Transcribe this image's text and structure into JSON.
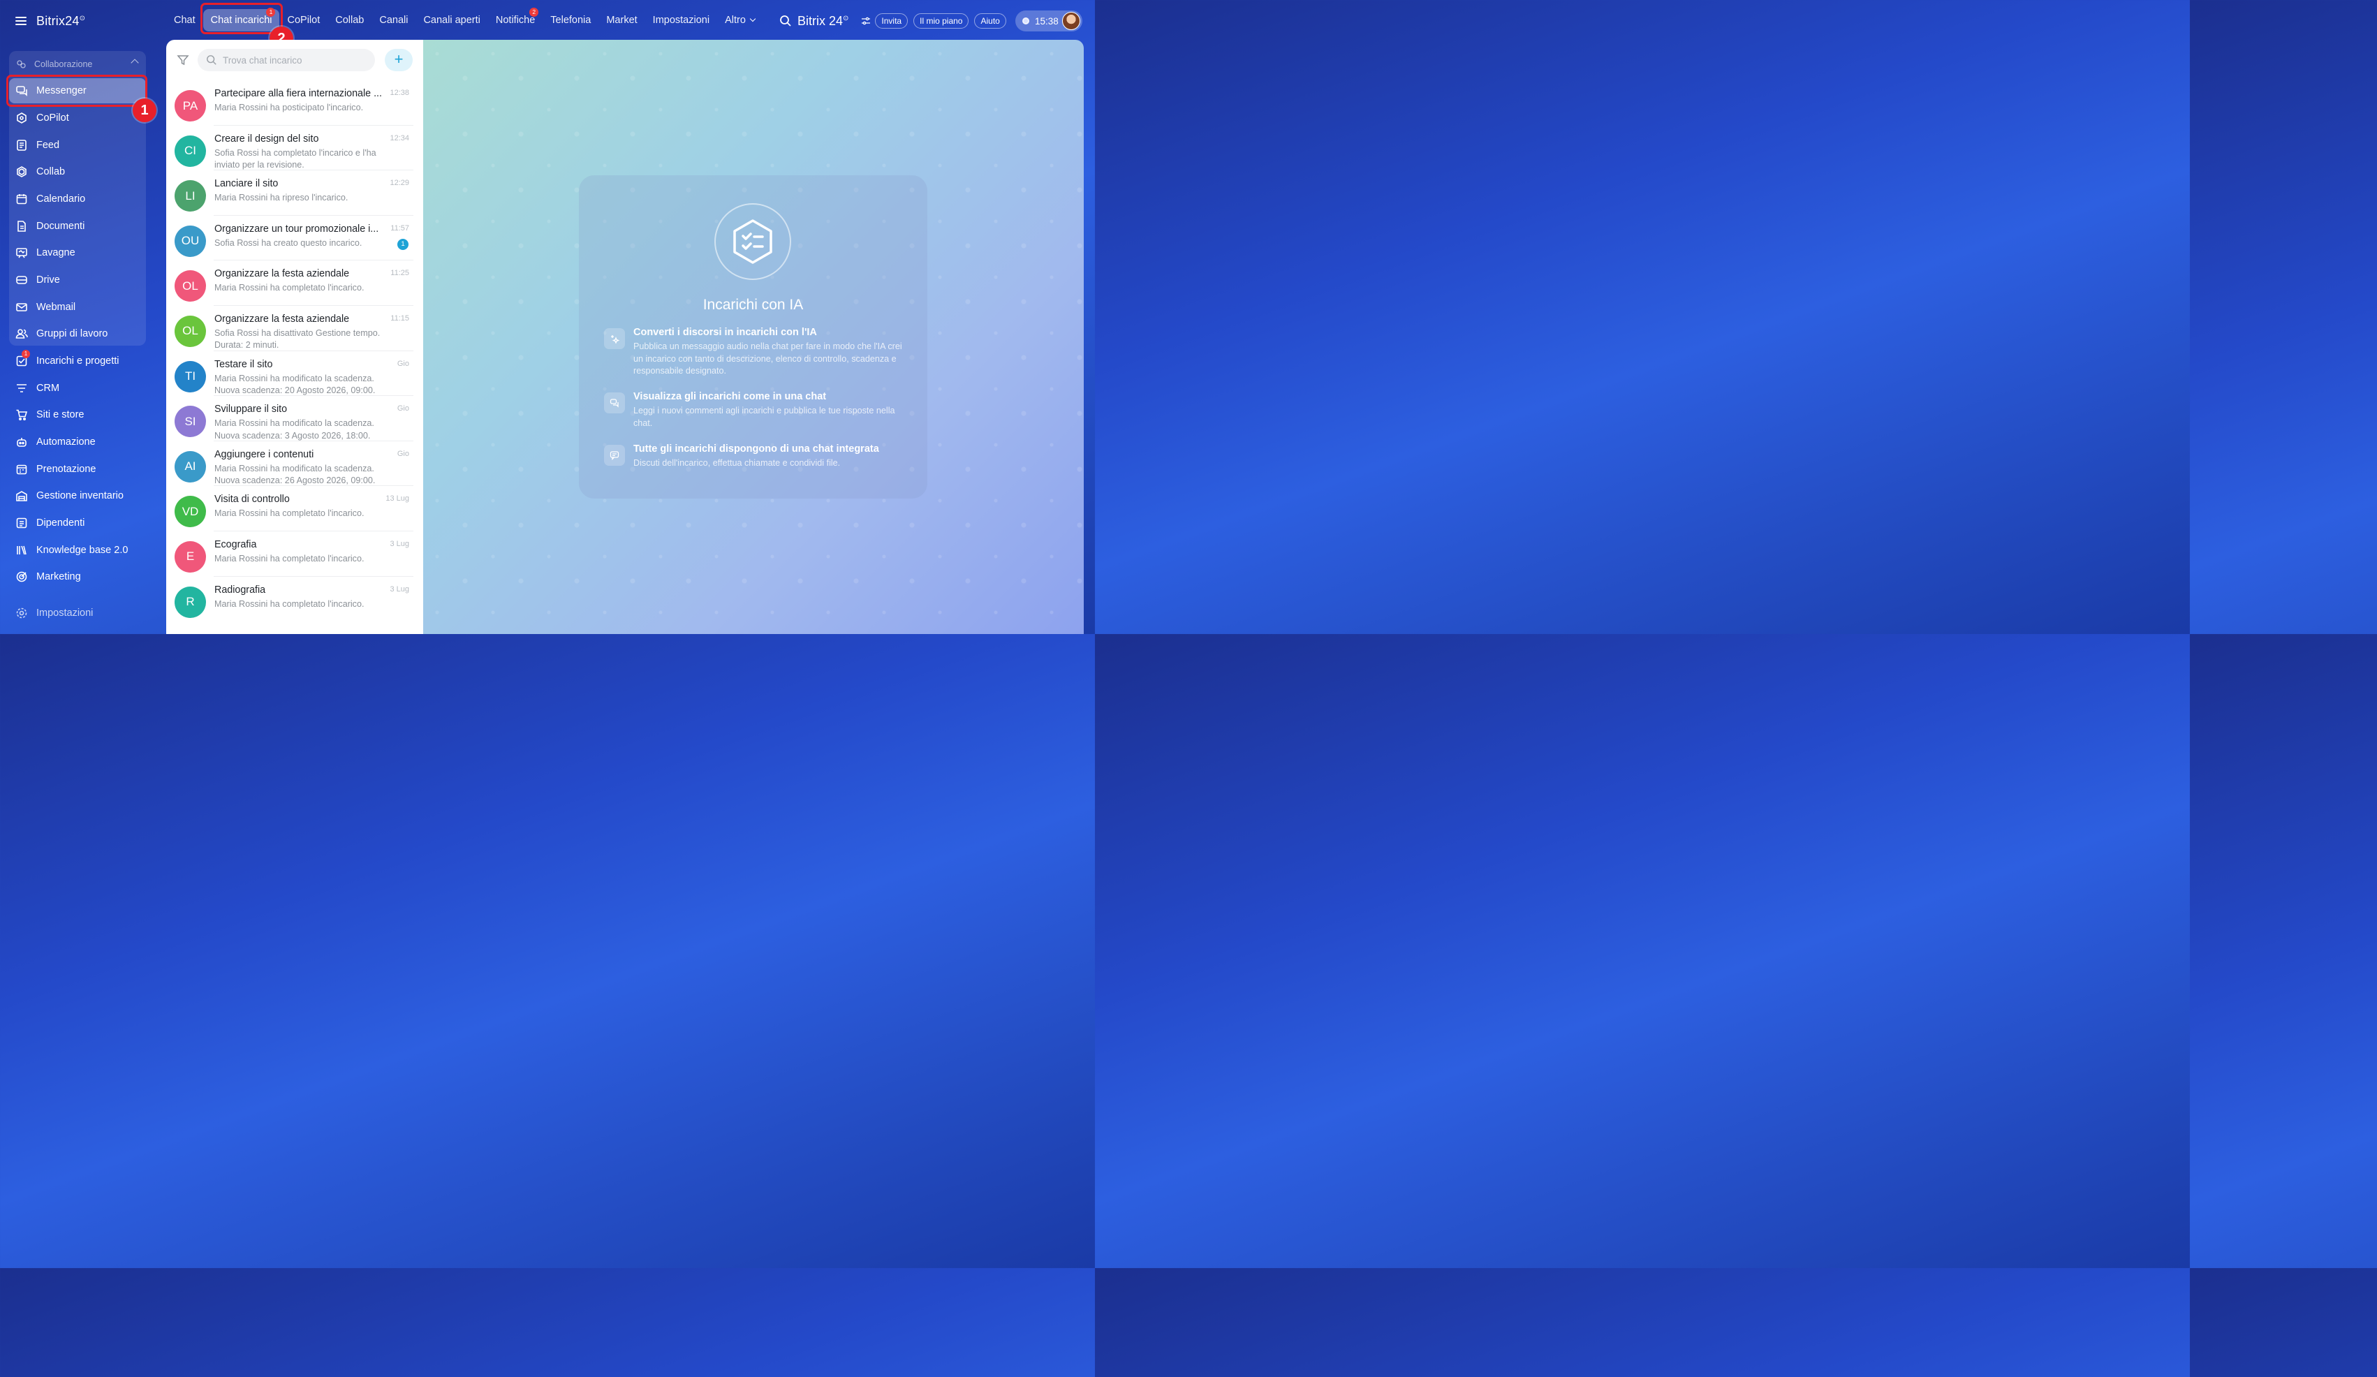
{
  "app": {
    "logo": "Bitrix24",
    "logo_mark": "⊙"
  },
  "sidebar": {
    "group_label": "Collaborazione",
    "items": [
      {
        "label": "Messenger"
      },
      {
        "label": "CoPilot"
      },
      {
        "label": "Feed"
      },
      {
        "label": "Collab"
      },
      {
        "label": "Calendario"
      },
      {
        "label": "Documenti"
      },
      {
        "label": "Lavagne"
      },
      {
        "label": "Drive"
      },
      {
        "label": "Webmail"
      },
      {
        "label": "Gruppi di lavoro"
      },
      {
        "label": "Incarichi e progetti",
        "badge": "1"
      },
      {
        "label": "CRM"
      },
      {
        "label": "Siti e store"
      },
      {
        "label": "Automazione"
      },
      {
        "label": "Prenotazione"
      },
      {
        "label": "Gestione inventario"
      },
      {
        "label": "Dipendenti"
      },
      {
        "label": "Knowledge base 2.0"
      },
      {
        "label": "Marketing"
      }
    ],
    "settings_label": "Impostazioni"
  },
  "callouts": {
    "one": "1",
    "two": "2"
  },
  "topnav": {
    "tabs": [
      {
        "label": "Chat"
      },
      {
        "label": "Chat incarichi",
        "badge": "1"
      },
      {
        "label": "CoPilot"
      },
      {
        "label": "Collab"
      },
      {
        "label": "Canali"
      },
      {
        "label": "Canali aperti"
      },
      {
        "label": "Notifiche",
        "badge": "2"
      },
      {
        "label": "Telefonia"
      },
      {
        "label": "Market"
      },
      {
        "label": "Impostazioni"
      },
      {
        "label": "Altro"
      }
    ],
    "brand": "Bitrix 24",
    "brand_mark": "⊙",
    "invite": "Invita",
    "plan": "Il mio piano",
    "help": "Aiuto",
    "clock": "15:38"
  },
  "list": {
    "search_placeholder": "Trova chat incarico",
    "add_label": "+",
    "rows": [
      {
        "initials": "PA",
        "color": "#f0577a",
        "title": "Partecipare alla fiera internazionale ...",
        "time": "12:38",
        "sub": "Maria Rossini ha posticipato l'incarico."
      },
      {
        "initials": "CI",
        "color": "#22b5a0",
        "title": "Creare il design del sito",
        "time": "12:34",
        "sub": "Sofia Rossi ha completato l'incarico e l'ha inviato per la revisione."
      },
      {
        "initials": "LI",
        "color": "#4ca36d",
        "title": "Lanciare il sito",
        "time": "12:29",
        "sub": "Maria Rossini ha ripreso l'incarico."
      },
      {
        "initials": "OU",
        "color": "#3a9ac9",
        "title": "Organizzare un tour promozionale i...",
        "time": "11:57",
        "sub": "Sofia Rossi ha creato questo incarico.",
        "count": "1"
      },
      {
        "initials": "OL",
        "color": "#f0577a",
        "title": "Organizzare la festa aziendale",
        "time": "11:25",
        "sub": "Maria Rossini ha completato l'incarico."
      },
      {
        "initials": "OL",
        "color": "#6ac53c",
        "title": "Organizzare la festa aziendale",
        "time": "11:15",
        "sub": "Sofia Rossi ha disattivato Gestione tempo. Durata: 2 minuti."
      },
      {
        "initials": "TI",
        "color": "#2383c9",
        "title": "Testare il sito",
        "time": "Gio",
        "sub": "Maria Rossini ha modificato la scadenza. Nuova scadenza: 20 Agosto 2026, 09:00."
      },
      {
        "initials": "SI",
        "color": "#8d79d4",
        "title": "Sviluppare il sito",
        "time": "Gio",
        "sub": "Maria Rossini ha modificato la scadenza. Nuova scadenza: 3 Agosto 2026, 18:00."
      },
      {
        "initials": "AI",
        "color": "#3a9ac9",
        "title": "Aggiungere i contenuti",
        "time": "Gio",
        "sub": "Maria Rossini ha modificato la scadenza. Nuova scadenza: 26 Agosto 2026, 09:00."
      },
      {
        "initials": "VD",
        "color": "#3fbb4a",
        "title": "Visita di controllo",
        "time": "13 Lug",
        "sub": "Maria Rossini ha completato l'incarico."
      },
      {
        "initials": "E",
        "color": "#f0577a",
        "title": "Ecografia",
        "time": "3 Lug",
        "sub": "Maria Rossini ha completato l'incarico."
      },
      {
        "initials": "R",
        "color": "#22b5a0",
        "title": "Radiografia",
        "time": "3 Lug",
        "sub": "Maria Rossini ha completato l'incarico."
      }
    ]
  },
  "promo": {
    "title": "Incarichi con IA",
    "features": [
      {
        "title": "Converti i discorsi in incarichi con l'IA",
        "desc": "Pubblica un messaggio audio nella chat per fare in modo che l'IA crei un incarico con tanto di descrizione, elenco di controllo, scadenza e responsabile designato."
      },
      {
        "title": "Visualizza gli incarichi come in una chat",
        "desc": "Leggi i nuovi commenti agli incarichi e pubblica le tue risposte nella chat."
      },
      {
        "title": "Tutte gli incarichi dispongono di una chat integrata",
        "desc": "Discuti dell'incarico, effettua chiamate e condividi file."
      }
    ]
  },
  "colors": {
    "accent": "#1ea3d6",
    "highlight": "#e8202a",
    "badge": "#ee3b3b"
  }
}
